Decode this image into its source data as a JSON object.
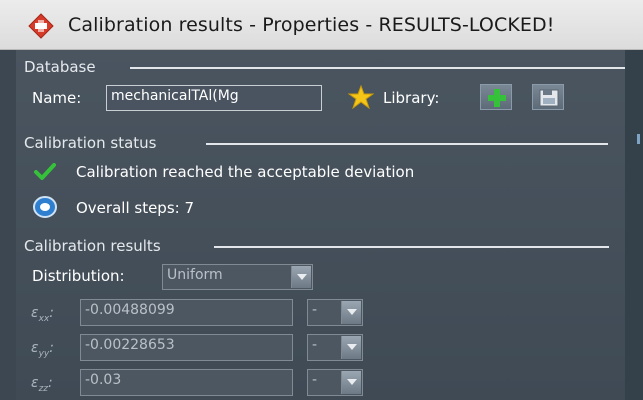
{
  "window": {
    "title": "Calibration results - Properties - RESULTS-LOCKED!"
  },
  "database": {
    "header": "Database",
    "name_label": "Name:",
    "name_value": "mechanicalTAl(Mg",
    "library_label": "Library:"
  },
  "calibration_status": {
    "header": "Calibration status",
    "message": "Calibration reached the acceptable deviation",
    "steps": "Overall steps: 7"
  },
  "calibration_results": {
    "header": "Calibration results",
    "distribution_label": "Distribution:",
    "distribution_value": "Uniform",
    "rows": [
      {
        "symbol": "ε",
        "sub": "xx",
        "value": "-0.00488099",
        "unit": "-"
      },
      {
        "symbol": "ε",
        "sub": "yy",
        "value": "-0.00228653",
        "unit": "-"
      },
      {
        "symbol": "ε",
        "sub": "zz",
        "value": "-0.03",
        "unit": "-"
      }
    ]
  },
  "icons": [
    "app-logo-icon",
    "star-icon",
    "plus-icon",
    "library-save-icon",
    "checkmark-icon",
    "steps-icon"
  ],
  "colors": {
    "accent_red": "#d63b2a",
    "check_green": "#35c23a",
    "star_yellow": "#f5c518",
    "panel": "#434e59"
  }
}
